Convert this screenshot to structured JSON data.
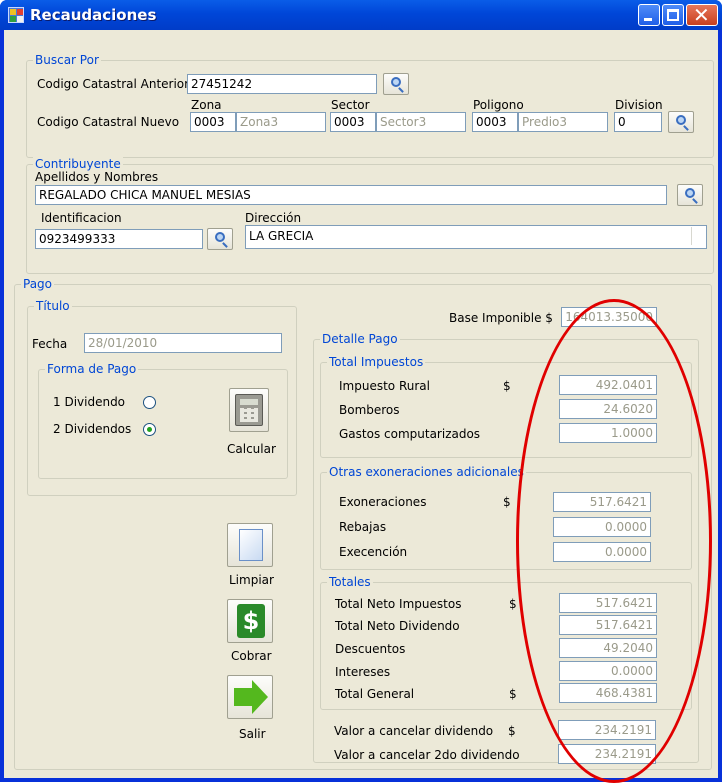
{
  "window": {
    "title": "Recaudaciones"
  },
  "buscar": {
    "group_title": "Buscar Por",
    "anterior_label": "Codigo Catastral Anterior",
    "anterior_value": "27451242",
    "nuevo_label": "Codigo Catastral Nuevo",
    "zona_label": "Zona",
    "sector_label": "Sector",
    "poligono_label": "Poligono",
    "division_label": "Division",
    "zona_value": "0003",
    "zona_name": "Zona3",
    "sector_value": "0003",
    "sector_name": "Sector3",
    "poligono_value": "0003",
    "poligono_name": "Predio3",
    "division_value": "0"
  },
  "contribuyente": {
    "group_title": "Contribuyente",
    "nombres_label": "Apellidos y Nombres",
    "nombres_value": "REGALADO CHICA MANUEL MESIAS",
    "identificacion_label": "Identificacion",
    "identificacion_value": "0923499333",
    "direccion_label": "Dirección",
    "direccion_value": "LA GRECIA"
  },
  "pago": {
    "group_title": "Pago",
    "titulo_group": "Título",
    "fecha_label": "Fecha",
    "fecha_value": "28/01/2010",
    "forma_group": "Forma de Pago",
    "option1": "1 Dividendo",
    "option2": "2 Dividendos",
    "option1_selected": false,
    "option2_selected": true,
    "calcular_label": "Calcular",
    "base_label": "Base Imponible $",
    "base_value": "164013.35000"
  },
  "detalle": {
    "group_title": "Detalle Pago",
    "total_impuestos_title": "Total Impuestos",
    "impuesto_rural_label": "Impuesto Rural",
    "impuesto_rural_value": "492.0401",
    "bomberos_label": "Bomberos",
    "bomberos_value": "24.6020",
    "gastos_label": "Gastos computarizados",
    "gastos_value": "1.0000",
    "otras_title": "Otras exoneraciones adicionales",
    "exoneraciones_label": "Exoneraciones",
    "exoneraciones_value": "517.6421",
    "rebajas_label": "Rebajas",
    "rebajas_value": "0.0000",
    "execencion_label": "Execención",
    "execencion_value": "0.0000",
    "totales_title": "Totales",
    "neto_impuestos_label": "Total Neto Impuestos",
    "neto_impuestos_value": "517.6421",
    "neto_dividendo_label": "Total Neto Dividendo",
    "neto_dividendo_value": "517.6421",
    "descuentos_label": "Descuentos",
    "descuentos_value": "49.2040",
    "intereses_label": "Intereses",
    "intereses_value": "0.0000",
    "total_general_label": "Total General",
    "total_general_value": "468.4381",
    "cancelar_dividendo_label": "Valor a cancelar dividendo",
    "cancelar_dividendo_value": "234.2191",
    "cancelar_2do_label": "Valor a cancelar 2do dividendo",
    "cancelar_2do_value": "234.2191",
    "currency": "$"
  },
  "actions": {
    "limpiar_label": "Limpiar",
    "cobrar_label": "Cobrar",
    "salir_label": "Salir"
  },
  "colors": {
    "title_bar": "#0046d8",
    "group_title": "#0046d5",
    "annotation_red": "#e00000"
  }
}
